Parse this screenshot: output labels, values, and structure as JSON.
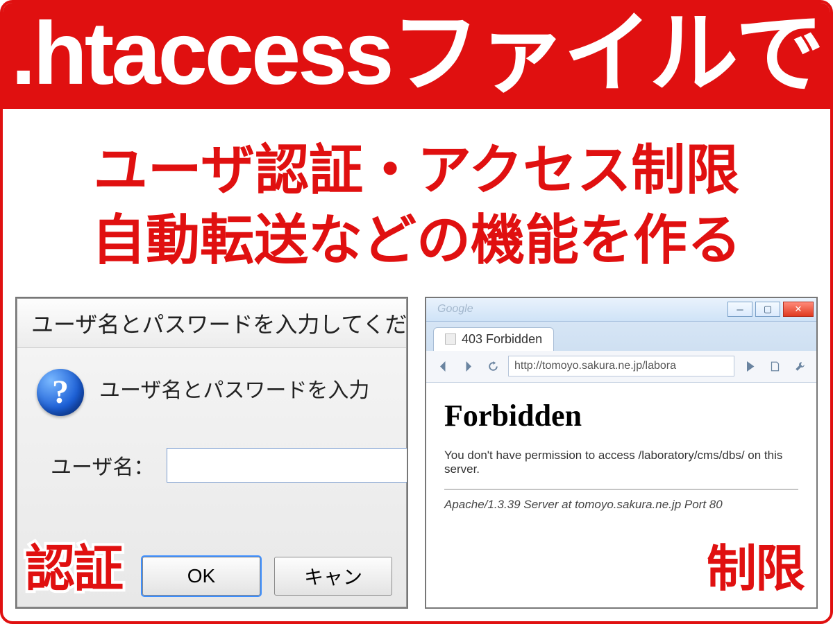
{
  "header": {
    "title": ".htaccessファイルで"
  },
  "subtitle": "ユーザ認証・アクセス制限\n自動転送などの機能を作る",
  "auth": {
    "window_title": "ユーザ名とパスワードを入力してください",
    "icon": "question-icon",
    "message": "ユーザ名とパスワードを入力",
    "username_label": "ユーザ名：",
    "username_value": "",
    "ok_label": "OK",
    "cancel_label": "キャン",
    "badge": "認証"
  },
  "browser": {
    "google_mark": "Google",
    "tab_title": "403 Forbidden",
    "url": "http://tomoyo.sakura.ne.jp/labora",
    "page_heading": "Forbidden",
    "page_body": "You don't have permission to access /laboratory/cms/dbs/ on this server.",
    "server_sig": "Apache/1.3.39 Server at tomoyo.sakura.ne.jp Port 80",
    "badge": "制限"
  },
  "colors": {
    "brand_red": "#e01010"
  }
}
